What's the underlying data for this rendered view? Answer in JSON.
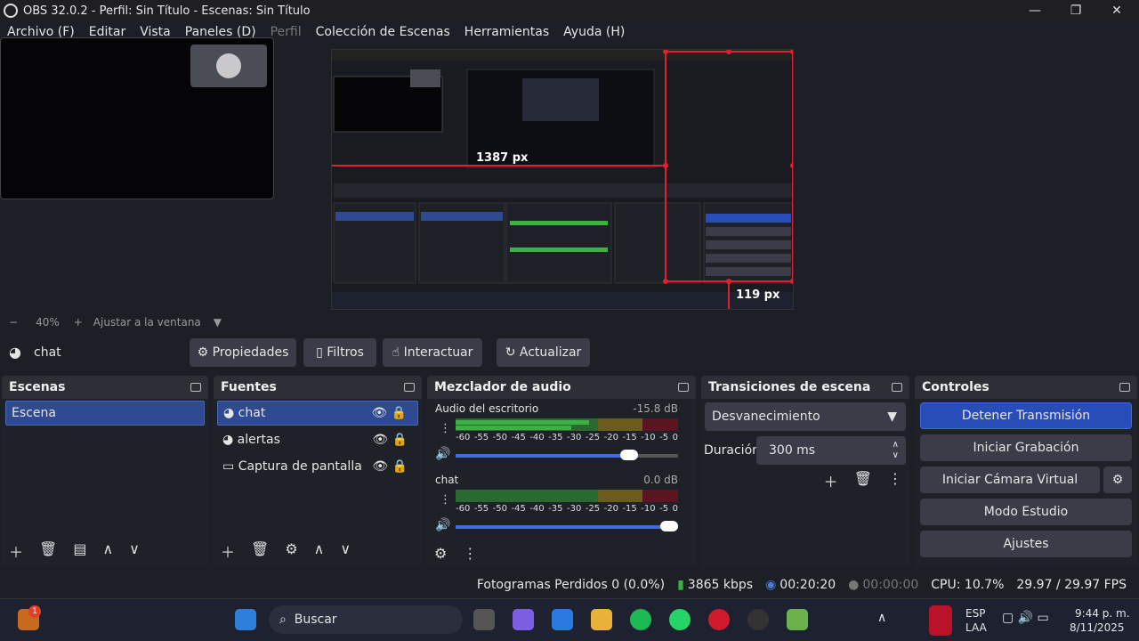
{
  "window": {
    "title": "OBS 32.0.2 - Perfil: Sin Título - Escenas: Sin Título",
    "minimize": "—",
    "maximize": "❐",
    "close": "✕"
  },
  "menu": [
    "Archivo (F)",
    "Editar",
    "Vista",
    "Paneles (D)",
    "Perfil",
    "Colección de Escenas",
    "Herramientas",
    "Ayuda (H)"
  ],
  "preview": {
    "width_label": "1387 px",
    "height_label": "119 px"
  },
  "zoom": {
    "minus": "−",
    "level": "40%",
    "plus": "+",
    "fit": "Ajustar a la ventana"
  },
  "source_toolbar": {
    "source": "chat",
    "properties": "Propiedades",
    "filters": "Filtros",
    "interact": "Interactuar",
    "refresh": "Actualizar"
  },
  "scenes": {
    "title": "Escenas",
    "items": [
      "Escena"
    ]
  },
  "sources": {
    "title": "Fuentes",
    "items": [
      "chat",
      "alertas",
      "Captura de pantalla"
    ]
  },
  "mixer": {
    "title": "Mezclador de audio",
    "tracks": [
      {
        "name": "Audio del escritorio",
        "db": "-15.8 dB",
        "volume": 0.82
      },
      {
        "name": "chat",
        "db": "0.0 dB",
        "volume": 1.0
      }
    ],
    "scale": [
      "-60",
      "-55",
      "-50",
      "-45",
      "-40",
      "-35",
      "-30",
      "-25",
      "-20",
      "-15",
      "-10",
      "-5",
      "0"
    ]
  },
  "transitions": {
    "title": "Transiciones de escena",
    "selected": "Desvanecimiento",
    "duration_label": "Duración",
    "duration": "300 ms"
  },
  "controls": {
    "title": "Controles",
    "stop_stream": "Detener Transmisión",
    "start_rec": "Iniciar Grabación",
    "virtual_cam": "Iniciar Cámara Virtual",
    "studio": "Modo Estudio",
    "settings": "Ajustes"
  },
  "status": {
    "dropped": "Fotogramas Perdidos 0 (0.0%)",
    "kbps": "3865 kbps",
    "stream_time": "00:20:20",
    "rec_time": "00:00:00",
    "cpu": "CPU: 10.7%",
    "fps": "29.97 / 29.97 FPS"
  },
  "taskbar": {
    "search": "Buscar",
    "lang1": "ESP",
    "lang2": "LAA",
    "time": "9:44 p. m.",
    "date": "8/11/2025",
    "badge": "1"
  },
  "colors": {
    "accent": "#284cb8",
    "selection": "#2f4a91",
    "meter_green": "#3cb043",
    "meter_yellow": "#b9a33a",
    "meter_red": "#8a1c2a"
  }
}
